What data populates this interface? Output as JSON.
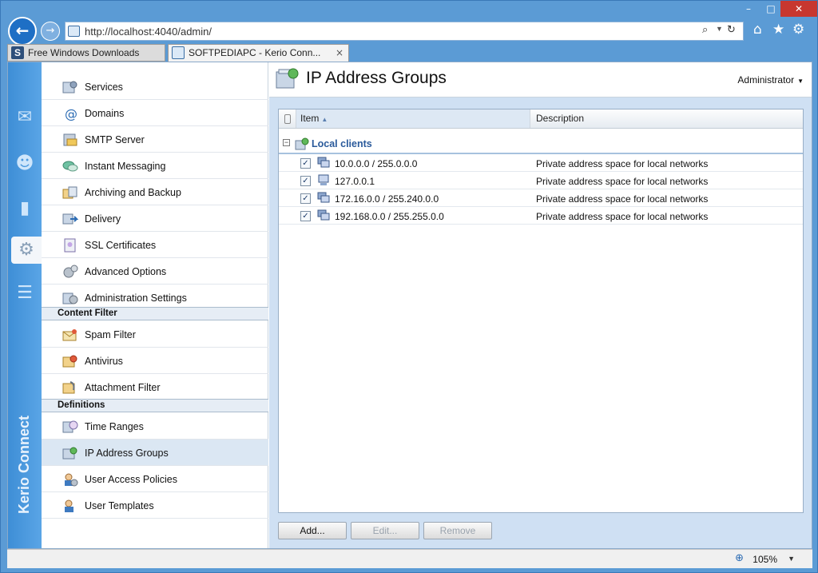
{
  "browser": {
    "url": "http://localhost:4040/admin/",
    "tabs": [
      {
        "label": "Free Windows Downloads",
        "active": false
      },
      {
        "label": "SOFTPEDIAPC - Kerio Conn...",
        "active": true
      }
    ],
    "tab_close": "×",
    "zoom": "105%"
  },
  "rail": {
    "brand": "Kerio Connect",
    "items": [
      "mail-icon",
      "users-icon",
      "statistics-icon",
      "settings-icon",
      "logs-icon"
    ],
    "active_index": 3
  },
  "menu": {
    "items": [
      {
        "label": "Services",
        "icon": "services-icon"
      },
      {
        "label": "Domains",
        "icon": "at-icon"
      },
      {
        "label": "SMTP Server",
        "icon": "smtp-icon"
      },
      {
        "label": "Instant Messaging",
        "icon": "chat-icon"
      },
      {
        "label": "Archiving and Backup",
        "icon": "archive-icon"
      },
      {
        "label": "Delivery",
        "icon": "delivery-icon"
      },
      {
        "label": "SSL Certificates",
        "icon": "certificate-icon"
      },
      {
        "label": "Advanced Options",
        "icon": "gears-icon"
      },
      {
        "label": "Administration Settings",
        "icon": "admin-settings-icon"
      }
    ],
    "content_filter": {
      "title": "Content Filter",
      "items": [
        {
          "label": "Spam Filter",
          "icon": "spam-icon"
        },
        {
          "label": "Antivirus",
          "icon": "antivirus-icon"
        },
        {
          "label": "Attachment Filter",
          "icon": "attachment-icon"
        }
      ]
    },
    "definitions": {
      "title": "Definitions",
      "items": [
        {
          "label": "Time Ranges",
          "icon": "clock-icon"
        },
        {
          "label": "IP Address Groups",
          "icon": "ip-groups-icon",
          "selected": true
        },
        {
          "label": "User Access Policies",
          "icon": "user-policy-icon"
        },
        {
          "label": "User Templates",
          "icon": "user-template-icon"
        }
      ]
    }
  },
  "main": {
    "title": "IP Address Groups",
    "user": "Administrator",
    "grid": {
      "columns": {
        "item": "Item",
        "description": "Description"
      },
      "group": {
        "label": "Local clients",
        "expander": "−"
      },
      "rows": [
        {
          "item": "10.0.0.0 / 255.0.0.0",
          "description": "Private address space for local networks",
          "checked": true
        },
        {
          "item": "127.0.0.1",
          "description": "Private address space for local networks",
          "checked": true
        },
        {
          "item": "172.16.0.0 / 255.240.0.0",
          "description": "Private address space for local networks",
          "checked": true
        },
        {
          "item": "192.168.0.0 / 255.255.0.0",
          "description": "Private address space for local networks",
          "checked": true
        }
      ]
    },
    "buttons": {
      "add": "Add...",
      "edit": "Edit...",
      "remove": "Remove"
    }
  },
  "colors": {
    "accent": "#3e8ed6",
    "group_label": "#2a5a9b",
    "selected_row": "#dbe7f3"
  }
}
